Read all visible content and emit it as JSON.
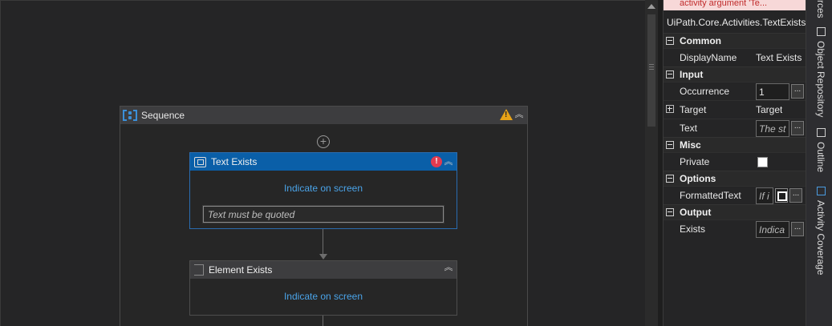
{
  "designer": {
    "sequence": {
      "title": "Sequence"
    },
    "text_exists": {
      "title": "Text Exists",
      "indicate_link": "Indicate on screen",
      "text_placeholder": "Text must be quoted"
    },
    "element_exists": {
      "title": "Element Exists",
      "indicate_link": "Indicate on screen"
    }
  },
  "properties": {
    "message": "activity argument 'Te...",
    "type_name": "UiPath.Core.Activities.TextExists",
    "sections": {
      "common": "Common",
      "input": "Input",
      "misc": "Misc",
      "options": "Options",
      "output": "Output"
    },
    "rows": {
      "display_name": {
        "label": "DisplayName",
        "value": "Text Exists"
      },
      "occurrence": {
        "label": "Occurrence",
        "value": "1"
      },
      "target": {
        "label": "Target",
        "value": "Target"
      },
      "text": {
        "label": "Text",
        "value": "The st"
      },
      "private": {
        "label": "Private"
      },
      "formatted_text": {
        "label": "FormattedText",
        "value": "If i"
      },
      "exists": {
        "label": "Exists",
        "value": "Indica"
      }
    },
    "ellipsis": "..."
  },
  "dock_tabs": {
    "resources": "rces",
    "object_repository": "Object Repository",
    "outline": "Outline",
    "activity_coverage": "Activity Coverage"
  },
  "colors": {
    "accent": "#0a5fa8",
    "link": "#4aa3e8",
    "error": "#e23b4f",
    "warning": "#e8a317"
  }
}
